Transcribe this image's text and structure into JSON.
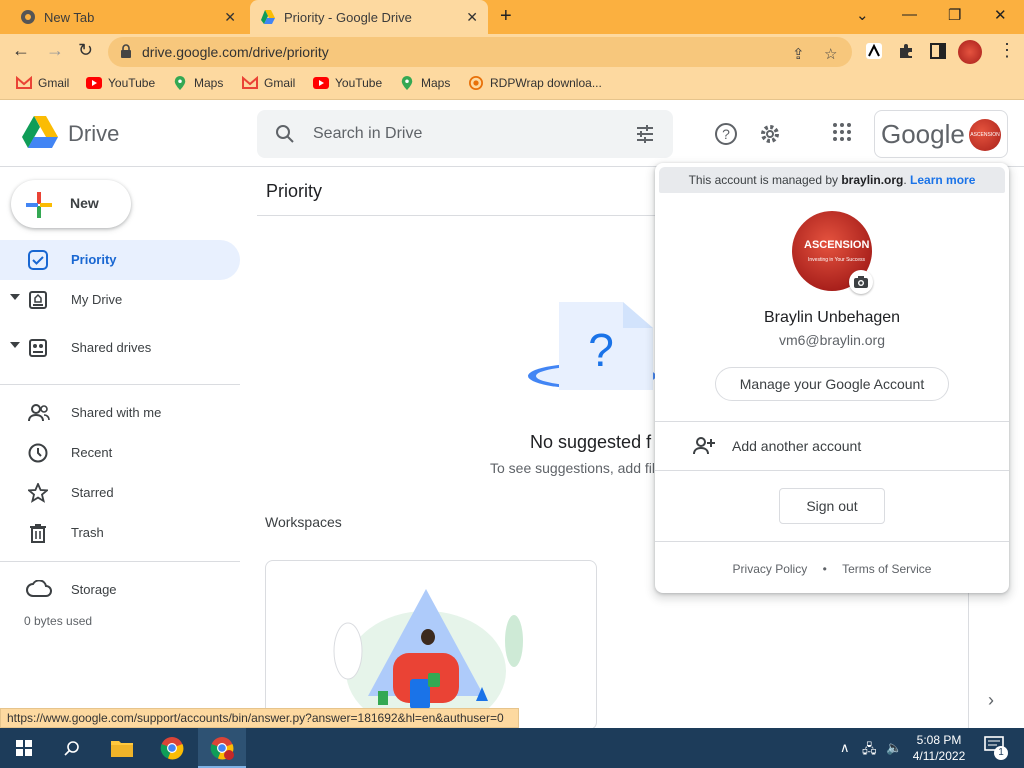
{
  "browser": {
    "tabs": [
      {
        "title": "New Tab"
      },
      {
        "title": "Priority - Google Drive"
      }
    ],
    "url": "drive.google.com/drive/priority",
    "bookmarks": [
      {
        "label": "Gmail"
      },
      {
        "label": "YouTube"
      },
      {
        "label": "Maps"
      },
      {
        "label": "Gmail"
      },
      {
        "label": "YouTube"
      },
      {
        "label": "Maps"
      },
      {
        "label": "RDPWrap downloa..."
      }
    ],
    "status_url": "https://www.google.com/support/accounts/bin/answer.py?answer=181692&hl=en&authuser=0"
  },
  "header": {
    "app_name": "Drive",
    "search_placeholder": "Search in Drive",
    "google_word": "Google",
    "avatar_text": "ASCENSION"
  },
  "sidebar": {
    "new_label": "New",
    "items": [
      {
        "label": "Priority"
      },
      {
        "label": "My Drive"
      },
      {
        "label": "Shared drives"
      },
      {
        "label": "Shared with me"
      },
      {
        "label": "Recent"
      },
      {
        "label": "Starred"
      },
      {
        "label": "Trash"
      },
      {
        "label": "Storage"
      }
    ],
    "storage_used": "0 bytes used"
  },
  "main": {
    "title": "Priority",
    "empty_title": "No suggested f",
    "empty_sub": "To see suggestions, add fil",
    "workspaces_title": "Workspaces"
  },
  "account_popup": {
    "managed_prefix": "This account is managed by ",
    "managed_domain": "braylin.org",
    "learn_more": "Learn more",
    "avatar_line1": "ASCENSION",
    "avatar_line2": "Investing in Your Success",
    "name": "Braylin Unbehagen",
    "email": "vm6@braylin.org",
    "manage_label": "Manage your Google Account",
    "add_account_label": "Add another account",
    "signout_label": "Sign out",
    "privacy_label": "Privacy Policy",
    "separator": "•",
    "terms_label": "Terms of Service"
  },
  "taskbar": {
    "time": "5:08 PM",
    "date": "4/11/2022",
    "notification_count": "1"
  },
  "colors": {
    "chrome_theme": "#fbb040",
    "chrome_toolbar": "#fdd9a0",
    "accent_blue": "#1a73e8",
    "taskbar": "#1d3c5a"
  }
}
